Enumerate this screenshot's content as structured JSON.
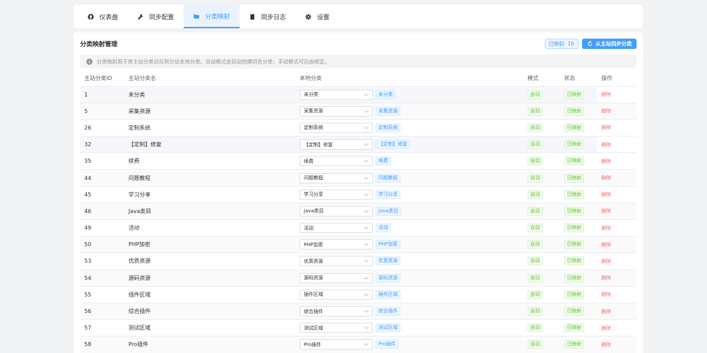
{
  "tabs": [
    {
      "label": "仪表盘",
      "icon": "github-icon"
    },
    {
      "label": "同步配置",
      "icon": "wrench-icon"
    },
    {
      "label": "分类映射",
      "icon": "folder-icon"
    },
    {
      "label": "同步日志",
      "icon": "document-icon"
    },
    {
      "label": "设置",
      "icon": "gear-icon"
    }
  ],
  "active_tab": 2,
  "card": {
    "title": "分类映射管理",
    "count_label": "已映射: 16",
    "sync_button": "从主站同步分类"
  },
  "info": "分类映射用于将主站分类对应到分站本地分类。自动模式会自动创建同名分类；手动模式可自由绑定。",
  "table": {
    "columns": [
      "主站分类ID",
      "主站分类名",
      "本地分类",
      "模式",
      "状态",
      "操作"
    ],
    "rows": [
      {
        "id": "1",
        "name": "未分类",
        "local": "未分类",
        "tag": "未分类",
        "mode": "自动",
        "status": "已映射",
        "action": "删除"
      },
      {
        "id": "5",
        "name": "采集资源",
        "local": "采集资源",
        "tag": "采集资源",
        "mode": "自动",
        "status": "已映射",
        "action": "删除"
      },
      {
        "id": "26",
        "name": "定制系统",
        "local": "定制系统",
        "tag": "定制系统",
        "mode": "自动",
        "status": "已映射",
        "action": "删除"
      },
      {
        "id": "32",
        "name": "【定制】修复",
        "local": "【定制】修复",
        "tag": "【定制】修复",
        "mode": "自动",
        "status": "已映射",
        "action": "删除"
      },
      {
        "id": "35",
        "name": "续费",
        "local": "续费",
        "tag": "续费",
        "mode": "自动",
        "status": "已映射",
        "action": "删除"
      },
      {
        "id": "44",
        "name": "问题教程",
        "local": "问题教程",
        "tag": "问题教程",
        "mode": "自动",
        "status": "已映射",
        "action": "删除"
      },
      {
        "id": "45",
        "name": "学习分享",
        "local": "学习分享",
        "tag": "学习分享",
        "mode": "自动",
        "status": "已映射",
        "action": "删除"
      },
      {
        "id": "46",
        "name": "Java类目",
        "local": "Java类目",
        "tag": "Java类目",
        "mode": "自动",
        "status": "已映射",
        "action": "删除"
      },
      {
        "id": "49",
        "name": "活动",
        "local": "活动",
        "tag": "活动",
        "mode": "自动",
        "status": "已映射",
        "action": "删除"
      },
      {
        "id": "50",
        "name": "PHP加密",
        "local": "PHP加密",
        "tag": "PHP加密",
        "mode": "自动",
        "status": "已映射",
        "action": "删除"
      },
      {
        "id": "53",
        "name": "优质资源",
        "local": "优质资源",
        "tag": "优质资源",
        "mode": "自动",
        "status": "已映射",
        "action": "删除"
      },
      {
        "id": "54",
        "name": "源码资源",
        "local": "源码资源",
        "tag": "源码资源",
        "mode": "自动",
        "status": "已映射",
        "action": "删除"
      },
      {
        "id": "55",
        "name": "插件区域",
        "local": "插件区域",
        "tag": "插件区域",
        "mode": "自动",
        "status": "已映射",
        "action": "删除"
      },
      {
        "id": "56",
        "name": "综合插件",
        "local": "综合插件",
        "tag": "综合插件",
        "mode": "自动",
        "status": "已映射",
        "action": "删除"
      },
      {
        "id": "57",
        "name": "测试区域",
        "local": "测试区域",
        "tag": "测试区域",
        "mode": "自动",
        "status": "已映射",
        "action": "删除"
      },
      {
        "id": "58",
        "name": "Pro插件",
        "local": "Pro插件",
        "tag": "Pro插件",
        "mode": "自动",
        "status": "已映射",
        "action": "删除"
      }
    ]
  },
  "colors": {
    "primary": "#409eff",
    "success": "#67c23a",
    "danger": "#f56c6c"
  }
}
